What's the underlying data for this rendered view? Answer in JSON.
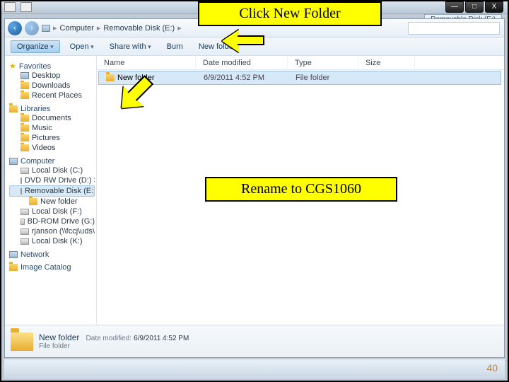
{
  "window_controls": {
    "min": "—",
    "max": "□",
    "close": "X"
  },
  "background_tab": "Removable Disk (E:)",
  "breadcrumb": {
    "seg1": "Computer",
    "seg2": "Removable Disk (E:)"
  },
  "toolbar": {
    "organize": "Organize",
    "open": "Open",
    "share": "Share with",
    "burn": "Burn",
    "new_folder": "New folder"
  },
  "sidebar": {
    "favorites": {
      "title": "Favorites",
      "items": [
        "Desktop",
        "Downloads",
        "Recent Places"
      ]
    },
    "libraries": {
      "title": "Libraries",
      "items": [
        "Documents",
        "Music",
        "Pictures",
        "Videos"
      ]
    },
    "computer": {
      "title": "Computer",
      "items": [
        "Local Disk (C:)",
        "DVD RW Drive (D:) S",
        "Removable Disk (E:)",
        "New folder",
        "Local Disk (F:)",
        "BD-ROM Drive (G:)",
        "rjanson (\\\\fccj\\uds\\",
        "Local Disk (K:)"
      ]
    },
    "network": "Network",
    "image_catalog": "Image Catalog"
  },
  "columns": {
    "name": "Name",
    "date": "Date modified",
    "type": "Type",
    "size": "Size"
  },
  "file_row": {
    "name": "New folder",
    "date": "6/9/2011 4:52 PM",
    "type": "File folder"
  },
  "details": {
    "title": "New folder",
    "date_label": "Date modified:",
    "date": "6/9/2011 4:52 PM",
    "type": "File folder"
  },
  "callouts": {
    "top": "Click New Folder",
    "mid": "Rename to CGS1060"
  },
  "slide_number": "40"
}
